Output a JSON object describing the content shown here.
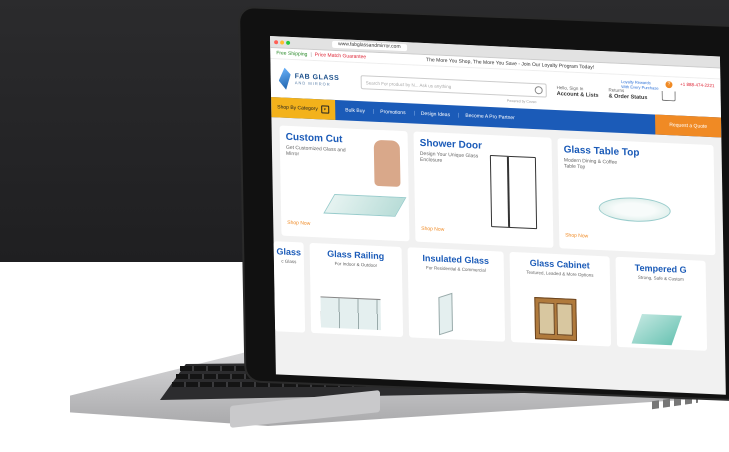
{
  "browser": {
    "url": "www.fabglassandmirror.com"
  },
  "promo_bar": {
    "free_shipping": "Free Shipping",
    "separator": "|",
    "price_match": "Price Match Guarantee",
    "loyalty_text": "The More You Shop, The More You Save - Join Our Loyalty Program Today!"
  },
  "header": {
    "logo_line1": "FAB GLASS",
    "logo_line2": "AND MIRROR",
    "search_placeholder": "Search For product by N...   Ask us anything",
    "powered_by": "Powered by Coveo",
    "loyalty_rewards": "Loyalty Rewards",
    "loyalty_sub": "With Every Purchase",
    "phone": "+1 888-474-2221",
    "account_greeting": "Hello, Sign In",
    "account_label": "Account & Lists",
    "returns_label": "Returns",
    "orders_label": "& Order Status"
  },
  "nav": {
    "shop_by_category": "Shop By Category",
    "items": [
      "Bulk Buy",
      "Promotions",
      "Design Ideas",
      "Become A Pro Partner"
    ],
    "quote": "Request a Quote"
  },
  "cards_row1": [
    {
      "title": "Custom Cut",
      "desc": "Get Customized Glass and Mirror",
      "cta": "Shop Now"
    },
    {
      "title": "Shower Door",
      "desc": "Design Your Unique Glass Enclosure",
      "cta": "Shop Now"
    },
    {
      "title": "Glass Table Top",
      "desc": "Modern Dining & Coffee Table Top",
      "cta": "Shop Now"
    }
  ],
  "cards_row2": [
    {
      "title": "Glass",
      "desc": "c Glass"
    },
    {
      "title": "Glass Railing",
      "desc": "For Indoor & Outdoor"
    },
    {
      "title": "Insulated Glass",
      "desc": "For Residential & Commercial"
    },
    {
      "title": "Glass Cabinet",
      "desc": "Textured, Leaded & More Options"
    },
    {
      "title": "Tempered G",
      "desc": "Strong, Safe & Custom"
    }
  ],
  "colors": {
    "brand_blue": "#1b5bb8",
    "accent_orange": "#f08a24",
    "category_yellow": "#f3b21b",
    "dark_background": "#2b2b2d"
  }
}
